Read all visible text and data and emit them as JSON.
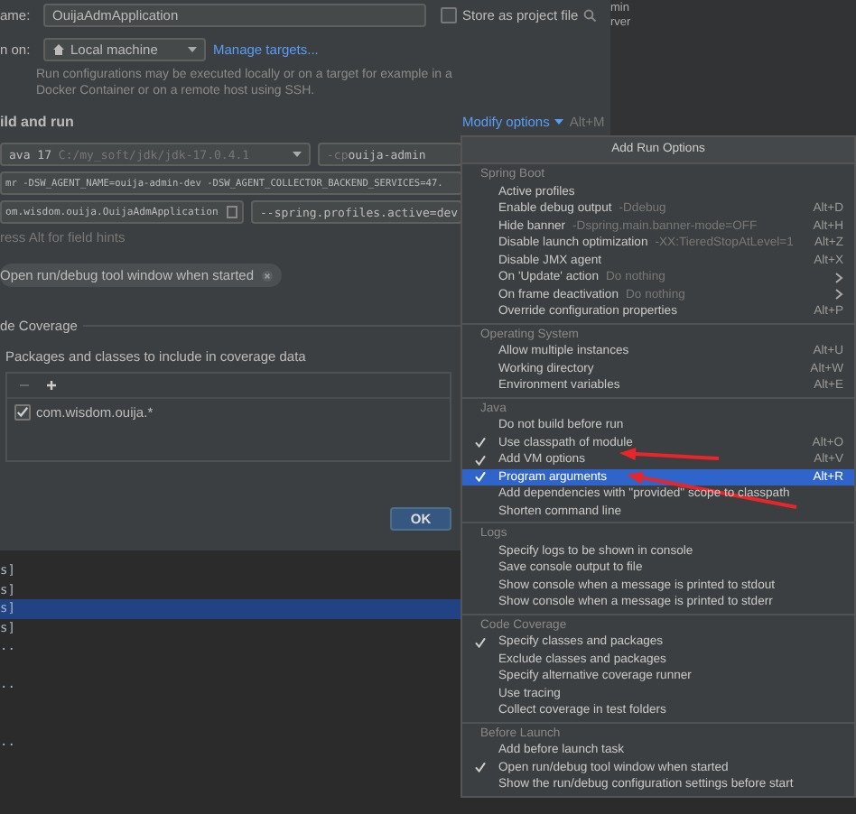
{
  "dialog": {
    "name_label": "ame:",
    "name_value": "OuijaAdmApplication",
    "store_as_project_file": {
      "label": "Store as project file",
      "checked": false
    },
    "run_on_label": "n on:",
    "run_on_value": "Local machine",
    "manage_targets": "Manage targets...",
    "run_on_hint": "Run configurations may be executed locally or on a target for example in a Docker Container or on a remote host using SSH.",
    "build_heading": "ild and run",
    "modify_options": "Modify options",
    "modify_shortcut": "Alt+M",
    "jdk": {
      "name": "ava 17",
      "path": "C:/my_soft/jdk/jdk-17.0.4.1"
    },
    "classpath": {
      "flag": "-cp",
      "value": "ouija-admin"
    },
    "vm_options": "mr -DSW_AGENT_NAME=ouija-admin-dev -DSW_AGENT_COLLECTOR_BACKEND_SERVICES=47.",
    "main_class": "om.wisdom.ouija.OuijaAdmApplication",
    "program_arguments": "--spring.profiles.active=dev",
    "field_hint": "ress Alt for field hints",
    "option_chips": [
      "Open run/debug tool window when started"
    ],
    "coverage_heading": "de Coverage",
    "coverage_label": "Packages and classes to include in coverage data",
    "coverage_items": [
      {
        "label": "com.wisdom.ouija.*",
        "checked": true
      }
    ],
    "ok_button": "OK"
  },
  "background_panel": {
    "lines": [
      "min",
      "rver"
    ]
  },
  "popup": {
    "title": "Add Run Options",
    "sections": [
      {
        "title": "Spring Boot",
        "items": [
          {
            "label": "Active profiles",
            "checked": false,
            "selected": false,
            "submenu": false
          },
          {
            "label": "Enable debug output",
            "hint": "-Ddebug",
            "shortcut": "Alt+D",
            "checked": false,
            "selected": false,
            "submenu": false
          },
          {
            "label": "Hide banner",
            "hint": "-Dspring.main.banner-mode=OFF",
            "shortcut": "Alt+H",
            "checked": false,
            "selected": false,
            "submenu": false
          },
          {
            "label": "Disable launch optimization",
            "hint": "-XX:TieredStopAtLevel=1",
            "shortcut": "Alt+Z",
            "checked": false,
            "selected": false,
            "submenu": false
          },
          {
            "label": "Disable JMX agent",
            "shortcut": "Alt+X",
            "checked": false,
            "selected": false,
            "submenu": false
          },
          {
            "label": "On 'Update' action",
            "hint": "Do nothing",
            "checked": false,
            "selected": false,
            "submenu": true
          },
          {
            "label": "On frame deactivation",
            "hint": "Do nothing",
            "checked": false,
            "selected": false,
            "submenu": true
          },
          {
            "label": "Override configuration properties",
            "shortcut": "Alt+P",
            "checked": false,
            "selected": false,
            "submenu": false
          }
        ]
      },
      {
        "title": "Operating System",
        "items": [
          {
            "label": "Allow multiple instances",
            "shortcut": "Alt+U",
            "checked": false,
            "selected": false,
            "submenu": false
          },
          {
            "label": "Working directory",
            "shortcut": "Alt+W",
            "checked": false,
            "selected": false,
            "submenu": false
          },
          {
            "label": "Environment variables",
            "shortcut": "Alt+E",
            "checked": false,
            "selected": false,
            "submenu": false
          }
        ]
      },
      {
        "title": "Java",
        "items": [
          {
            "label": "Do not build before run",
            "checked": false,
            "selected": false,
            "submenu": false
          },
          {
            "label": "Use classpath of module",
            "shortcut": "Alt+O",
            "checked": true,
            "selected": false,
            "submenu": false
          },
          {
            "label": "Add VM options",
            "shortcut": "Alt+V",
            "checked": true,
            "selected": false,
            "submenu": false
          },
          {
            "label": "Program arguments",
            "shortcut": "Alt+R",
            "checked": true,
            "selected": true,
            "submenu": false
          },
          {
            "label": "Add dependencies with \"provided\" scope to classpath",
            "checked": false,
            "selected": false,
            "submenu": false
          },
          {
            "label": "Shorten command line",
            "checked": false,
            "selected": false,
            "submenu": false
          }
        ]
      },
      {
        "title": "Logs",
        "items": [
          {
            "label": "Specify logs to be shown in console",
            "checked": false,
            "selected": false,
            "submenu": false
          },
          {
            "label": "Save console output to file",
            "checked": false,
            "selected": false,
            "submenu": false
          },
          {
            "label": "Show console when a message is printed to stdout",
            "checked": false,
            "selected": false,
            "submenu": false
          },
          {
            "label": "Show console when a message is printed to stderr",
            "checked": false,
            "selected": false,
            "submenu": false
          }
        ]
      },
      {
        "title": "Code Coverage",
        "items": [
          {
            "label": "Specify classes and packages",
            "checked": true,
            "selected": false,
            "submenu": false
          },
          {
            "label": "Exclude classes and packages",
            "checked": false,
            "selected": false,
            "submenu": false
          },
          {
            "label": "Specify alternative coverage runner",
            "checked": false,
            "selected": false,
            "submenu": false
          },
          {
            "label": "Use tracing",
            "checked": false,
            "selected": false,
            "submenu": false
          },
          {
            "label": "Collect coverage in test folders",
            "checked": false,
            "selected": false,
            "submenu": false
          }
        ]
      },
      {
        "title": "Before Launch",
        "items": [
          {
            "label": "Add before launch task",
            "checked": false,
            "selected": false,
            "submenu": false
          },
          {
            "label": "Open run/debug tool window when started",
            "checked": true,
            "selected": false,
            "submenu": false
          },
          {
            "label": "Show the run/debug configuration settings before start",
            "checked": false,
            "selected": false,
            "submenu": false
          }
        ]
      }
    ]
  },
  "console": {
    "lines": [
      {
        "kind": "text",
        "text": "s]",
        "selected": false
      },
      {
        "kind": "text",
        "text": "s]",
        "selected": false
      },
      {
        "kind": "text",
        "text": "s]",
        "selected": true
      },
      {
        "kind": "text",
        "text": "s]",
        "selected": false
      },
      {
        "kind": "text",
        "text": "..",
        "selected": false
      },
      {
        "kind": "blank"
      },
      {
        "kind": "text",
        "text": "..",
        "selected": false
      },
      {
        "kind": "blank"
      },
      {
        "kind": "blank"
      },
      {
        "kind": "text",
        "text": "..",
        "selected": false
      }
    ]
  },
  "annotations": [
    {
      "kind": "arrow"
    },
    {
      "kind": "arrow"
    }
  ]
}
